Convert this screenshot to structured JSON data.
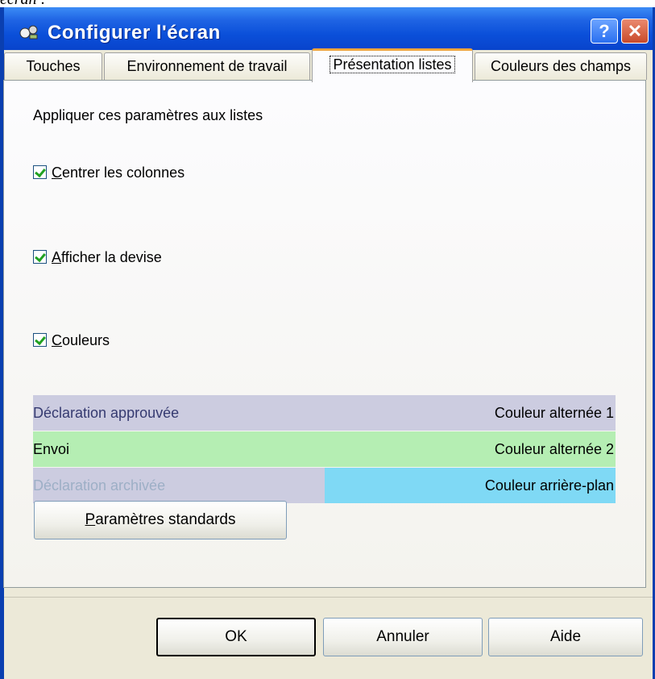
{
  "caption": "écran :",
  "window": {
    "title": "Configurer l'écran",
    "help_label": "?",
    "close_label": "✕"
  },
  "tabs": {
    "touches": "Touches",
    "environnement": "Environnement de travail",
    "presentation": "Présentation listes",
    "couleurs": "Couleurs des champs",
    "active": "Présentation listes"
  },
  "panel": {
    "heading": "Appliquer ces paramètres aux listes",
    "checkboxes": [
      {
        "mnemonic": "C",
        "rest": "entrer les colonnes",
        "checked": true
      },
      {
        "mnemonic": "A",
        "rest": "fficher la devise",
        "checked": true
      },
      {
        "mnemonic": "C",
        "rest": "ouleurs",
        "checked": true
      }
    ],
    "color_rows": [
      {
        "label": "Déclaration approuvée",
        "setting": "Couleur alternée 1",
        "color": "#cccce0"
      },
      {
        "label": "Envoi",
        "setting": "Couleur alternée 2",
        "color": "#b5eeb3"
      },
      {
        "label": "Déclaration archivée",
        "setting": "Couleur arrière-plan",
        "color": "#7fd9f5",
        "label_color": "#9dafc6"
      }
    ],
    "standard_button": {
      "mnemonic": "P",
      "rest": "aramètres standards"
    }
  },
  "footer": {
    "ok": "OK",
    "cancel": "Annuler",
    "help": "Aide"
  }
}
